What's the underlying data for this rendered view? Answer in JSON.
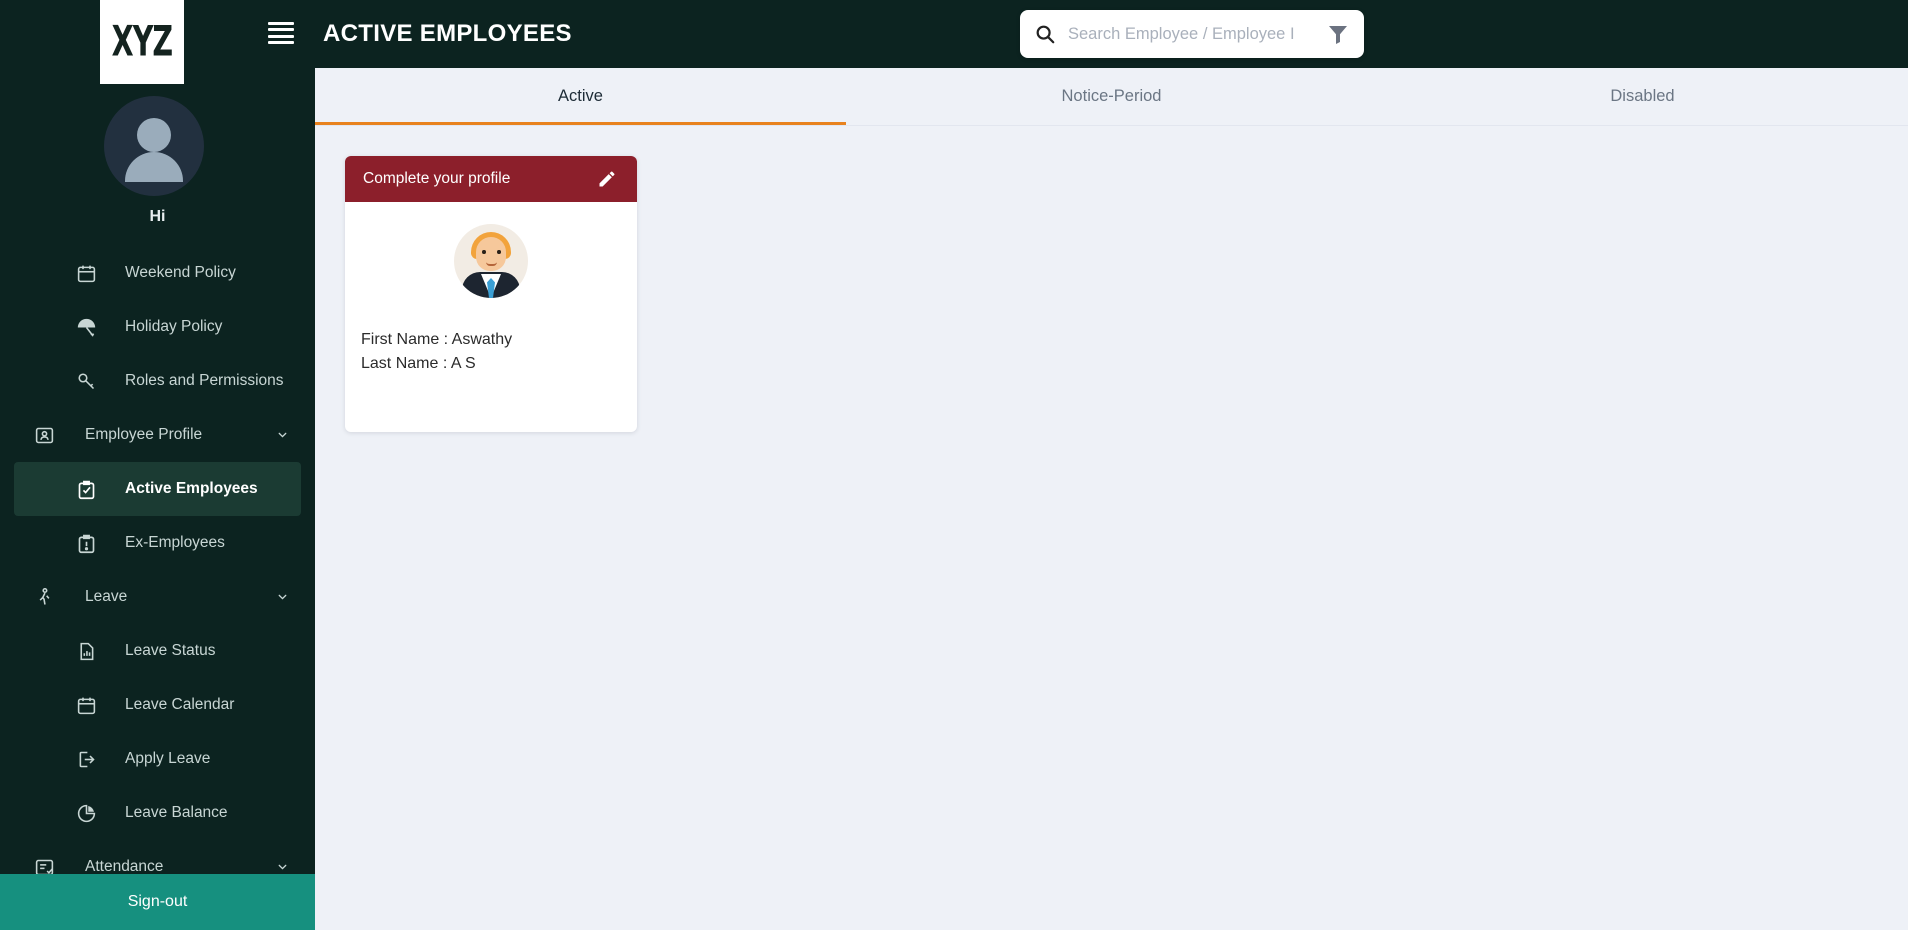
{
  "brand": {
    "logo_text": "XYZ"
  },
  "colors": {
    "sidebar_bg": "#0c2320",
    "sidebar_active_bg": "#1b3b33",
    "signout_bg": "#16907f",
    "tab_indicator": "#e8821e",
    "card_header_bg": "#8c1f2b",
    "content_bg": "#eef1f7"
  },
  "sidebar": {
    "greeting": "Hi",
    "signout_label": "Sign-out",
    "items": [
      {
        "label": "Weekend Policy",
        "icon": "calendar-icon",
        "level": "sub",
        "active": false,
        "expandable": false,
        "clipped": true
      },
      {
        "label": "Holiday Policy",
        "icon": "beach-umbrella-icon",
        "level": "sub",
        "active": false,
        "expandable": false
      },
      {
        "label": "Roles and Permissions",
        "icon": "key-icon",
        "level": "sub",
        "active": false,
        "expandable": false
      },
      {
        "label": "Employee Profile",
        "icon": "id-card-icon",
        "level": "top",
        "active": false,
        "expandable": true
      },
      {
        "label": "Active Employees",
        "icon": "clipboard-check-icon",
        "level": "sub",
        "active": true,
        "expandable": false
      },
      {
        "label": "Ex-Employees",
        "icon": "clipboard-alert-icon",
        "level": "sub",
        "active": false,
        "expandable": false
      },
      {
        "label": "Leave",
        "icon": "walking-person-icon",
        "level": "top",
        "active": false,
        "expandable": true
      },
      {
        "label": "Leave Status",
        "icon": "report-chart-icon",
        "level": "sub",
        "active": false,
        "expandable": false
      },
      {
        "label": "Leave Calendar",
        "icon": "calendar-icon",
        "level": "sub",
        "active": false,
        "expandable": false
      },
      {
        "label": "Apply Leave",
        "icon": "logout-arrow-icon",
        "level": "sub",
        "active": false,
        "expandable": false
      },
      {
        "label": "Leave Balance",
        "icon": "pie-chart-icon",
        "level": "sub",
        "active": false,
        "expandable": false
      },
      {
        "label": "Attendance",
        "icon": "checklist-icon",
        "level": "top",
        "active": false,
        "expandable": true
      }
    ]
  },
  "header": {
    "title": "ACTIVE EMPLOYEES",
    "menu_icon": "hamburger-icon"
  },
  "search": {
    "placeholder": "Search Employee / Employee I",
    "value": "",
    "search_icon": "magnifier-icon",
    "filter_icon": "funnel-filter-icon"
  },
  "tabs": [
    {
      "label": "Active",
      "selected": true
    },
    {
      "label": "Notice-Period",
      "selected": false
    },
    {
      "label": "Disabled",
      "selected": false
    }
  ],
  "profile_card": {
    "header_title": "Complete your profile",
    "edit_icon": "pencil-icon",
    "avatar_icon": "employee-portrait-avatar",
    "fields": [
      "First Name : Aswathy",
      "Last Name : A S"
    ]
  }
}
